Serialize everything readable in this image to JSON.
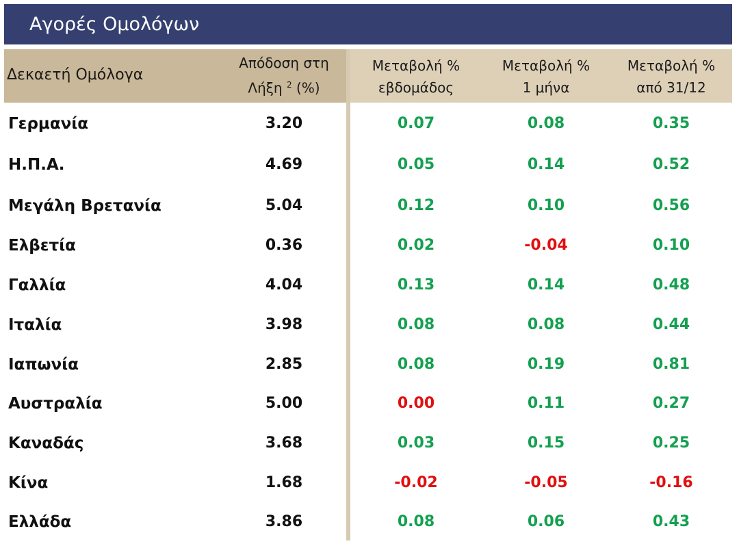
{
  "title": "Αγορές Ομολόγων",
  "colors": {
    "title_bg": "#354070",
    "header_left_bg": "#c9b899",
    "header_right_bg": "#ddd0b7",
    "positive": "#14a050",
    "negative": "#e01010"
  },
  "headers": {
    "name": "Δεκαετή Ομόλογα",
    "yield_line1": "Απόδοση στη",
    "yield_line2": "Λήξη",
    "yield_sup": "2",
    "yield_unit": "(%)",
    "week_line1": "Μεταβολή %",
    "week_line2": "εβδομάδος",
    "month_line1": "Μεταβολή %",
    "month_line2": "1 μήνα",
    "ytd_line1": "Μεταβολή %",
    "ytd_line2": "από 31/12"
  },
  "rows": [
    {
      "name": "Γερμανία",
      "yield": "3.20",
      "week": "0.07",
      "month": "0.08",
      "ytd": "0.35"
    },
    {
      "name": "Η.Π.Α.",
      "yield": "4.69",
      "week": "0.05",
      "month": "0.14",
      "ytd": "0.52"
    },
    {
      "name": "Μεγάλη Βρετανία",
      "yield": "5.04",
      "week": "0.12",
      "month": "0.10",
      "ytd": "0.56"
    },
    {
      "name": "Ελβετία",
      "yield": "0.36",
      "week": "0.02",
      "month": "-0.04",
      "ytd": "0.10"
    },
    {
      "name": "Γαλλία",
      "yield": "4.04",
      "week": "0.13",
      "month": "0.14",
      "ytd": "0.48"
    },
    {
      "name": "Ιταλία",
      "yield": "3.98",
      "week": "0.08",
      "month": "0.08",
      "ytd": "0.44"
    },
    {
      "name": "Ιαπωνία",
      "yield": "2.85",
      "week": "0.08",
      "month": "0.19",
      "ytd": "0.81"
    },
    {
      "name": "Αυστραλία",
      "yield": "5.00",
      "week": "0.00",
      "month": "0.11",
      "ytd": "0.27"
    },
    {
      "name": "Καναδάς",
      "yield": "3.68",
      "week": "0.03",
      "month": "0.15",
      "ytd": "0.25"
    },
    {
      "name": "Κίνα",
      "yield": "1.68",
      "week": "-0.02",
      "month": "-0.05",
      "ytd": "-0.16"
    },
    {
      "name": "Ελλάδα",
      "yield": "3.86",
      "week": "0.08",
      "month": "0.06",
      "ytd": "0.43"
    }
  ],
  "cell_tones": {
    "Αυστραλία.week": "negative"
  }
}
